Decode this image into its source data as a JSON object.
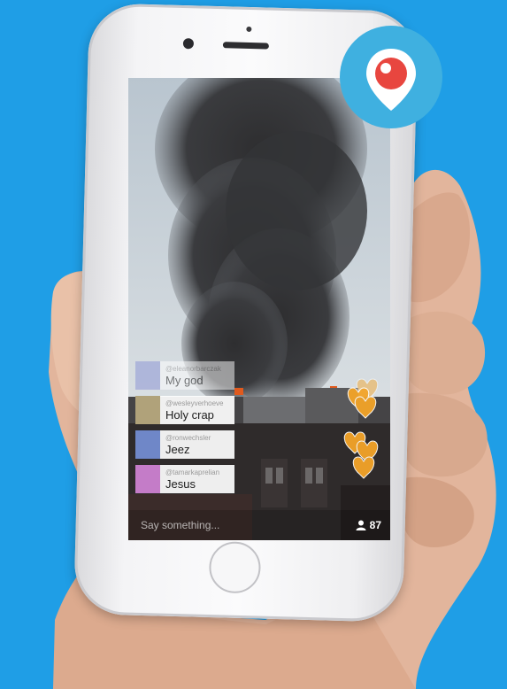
{
  "comments": [
    {
      "user": "@eleanorbarczak",
      "text": "My god",
      "avatar_color": "#8f98d6"
    },
    {
      "user": "@wesleyverhoeve",
      "text": "Holy crap",
      "avatar_color": "#b0a27a"
    },
    {
      "user": "@ronwechsler",
      "text": "Jeez",
      "avatar_color": "#6f87c8"
    },
    {
      "user": "@tamarkaprelian",
      "text": "Jesus",
      "avatar_color": "#c47cc8"
    }
  ],
  "composer": {
    "placeholder": "Say something..."
  },
  "viewers": {
    "count": "87",
    "icon": "person-icon"
  },
  "colors": {
    "background": "#1f9ee6",
    "logo_bg": "#3fb0e0",
    "logo_pin": "#e8463f",
    "heart": "#f3a428"
  }
}
